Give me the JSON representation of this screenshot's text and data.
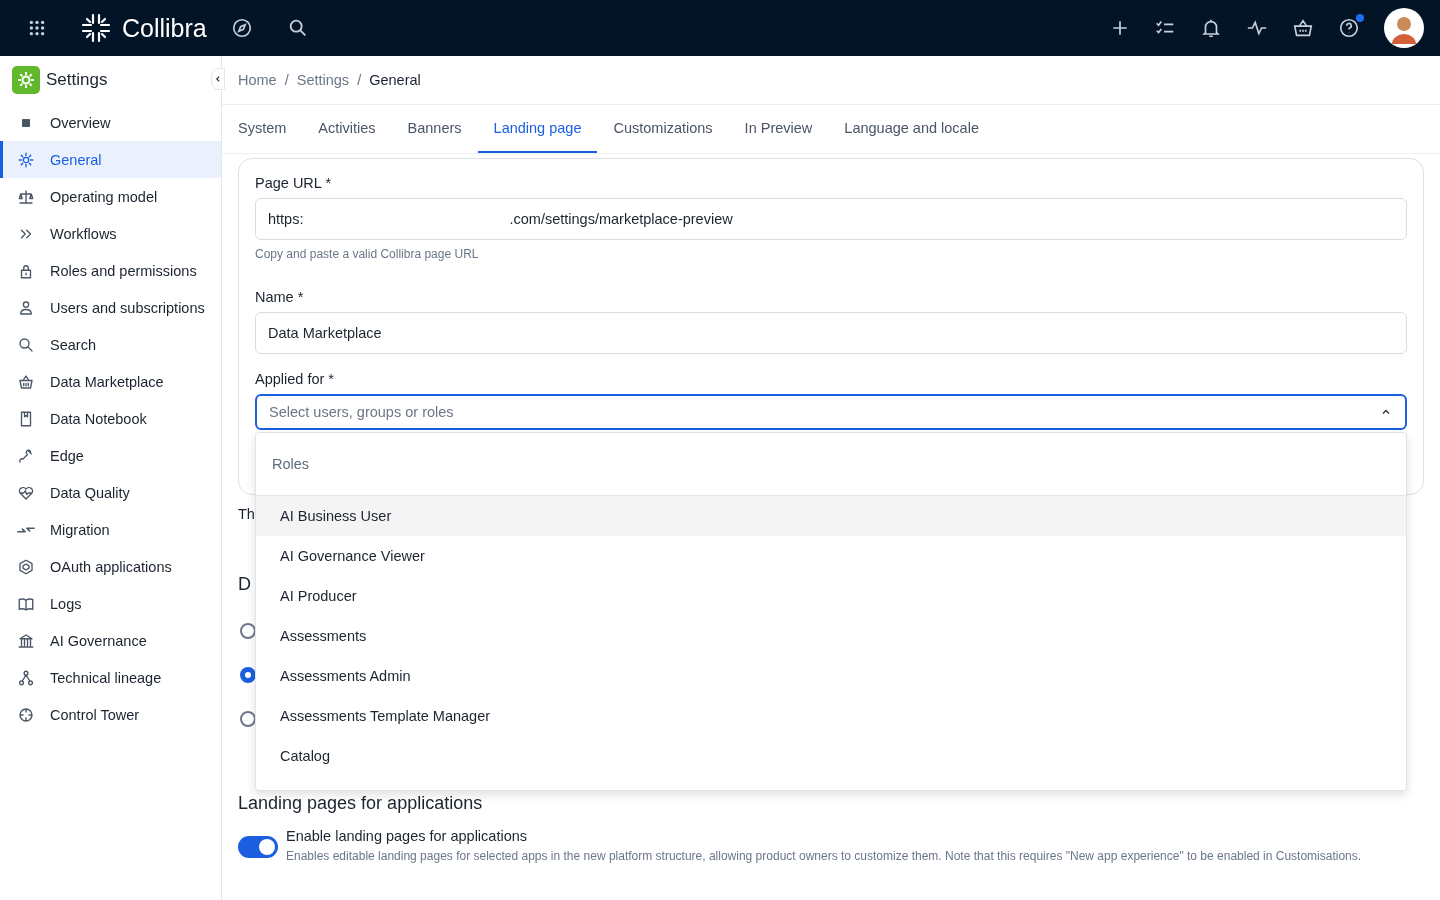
{
  "topbar": {
    "brand": "Collibra",
    "notification_dot": true
  },
  "sidebar": {
    "title": "Settings",
    "items": [
      {
        "label": "Overview",
        "selected": false
      },
      {
        "label": "General",
        "selected": true
      },
      {
        "label": "Operating model",
        "selected": false
      },
      {
        "label": "Workflows",
        "selected": false
      },
      {
        "label": "Roles and permissions",
        "selected": false
      },
      {
        "label": "Users and subscriptions",
        "selected": false
      },
      {
        "label": "Search",
        "selected": false
      },
      {
        "label": "Data Marketplace",
        "selected": false
      },
      {
        "label": "Data Notebook",
        "selected": false
      },
      {
        "label": "Edge",
        "selected": false
      },
      {
        "label": "Data Quality",
        "selected": false
      },
      {
        "label": "Migration",
        "selected": false
      },
      {
        "label": "OAuth applications",
        "selected": false
      },
      {
        "label": "Logs",
        "selected": false
      },
      {
        "label": "AI Governance",
        "selected": false
      },
      {
        "label": "Technical lineage",
        "selected": false
      },
      {
        "label": "Control Tower",
        "selected": false
      }
    ]
  },
  "breadcrumb": {
    "separator": "/",
    "items": [
      "Home",
      "Settings",
      "General"
    ]
  },
  "tabs": [
    {
      "label": "System",
      "selected": false
    },
    {
      "label": "Activities",
      "selected": false
    },
    {
      "label": "Banners",
      "selected": false
    },
    {
      "label": "Landing page",
      "selected": true
    },
    {
      "label": "Customizations",
      "selected": false
    },
    {
      "label": "In Preview",
      "selected": false
    },
    {
      "label": "Language and locale",
      "selected": false
    }
  ],
  "form": {
    "page_url": {
      "label": "Page URL *",
      "value_parts": [
        "https:",
        ".com/settings/marketplace-preview"
      ],
      "help": "Copy and paste a valid Collibra page URL"
    },
    "name": {
      "label": "Name *",
      "value": "Data Marketplace"
    },
    "applied_for": {
      "label": "Applied for *",
      "placeholder": "Select users, groups or roles",
      "expanded": true,
      "dropdown": {
        "group": "Roles",
        "options": [
          {
            "label": "AI Business User",
            "highlighted": true
          },
          {
            "label": "AI Governance Viewer",
            "highlighted": false
          },
          {
            "label": "AI Producer",
            "highlighted": false
          },
          {
            "label": "Assessments",
            "highlighted": false
          },
          {
            "label": "Assessments Admin",
            "highlighted": false
          },
          {
            "label": "Assessments Template Manager",
            "highlighted": false
          },
          {
            "label": "Catalog",
            "highlighted": false
          }
        ]
      }
    }
  },
  "partial_text": "Th",
  "partial_heading": "D",
  "radios": [
    {
      "selected": false
    },
    {
      "selected": true
    },
    {
      "selected": false
    }
  ],
  "applications": {
    "heading": "Landing pages for applications",
    "toggle": {
      "label": "Enable landing pages for applications",
      "on": true,
      "description": "Enables editable landing pages for selected apps in the new platform structure, allowing product owners to customize them. Note that this requires \"New app experience\" to be enabled in Customisations."
    }
  }
}
